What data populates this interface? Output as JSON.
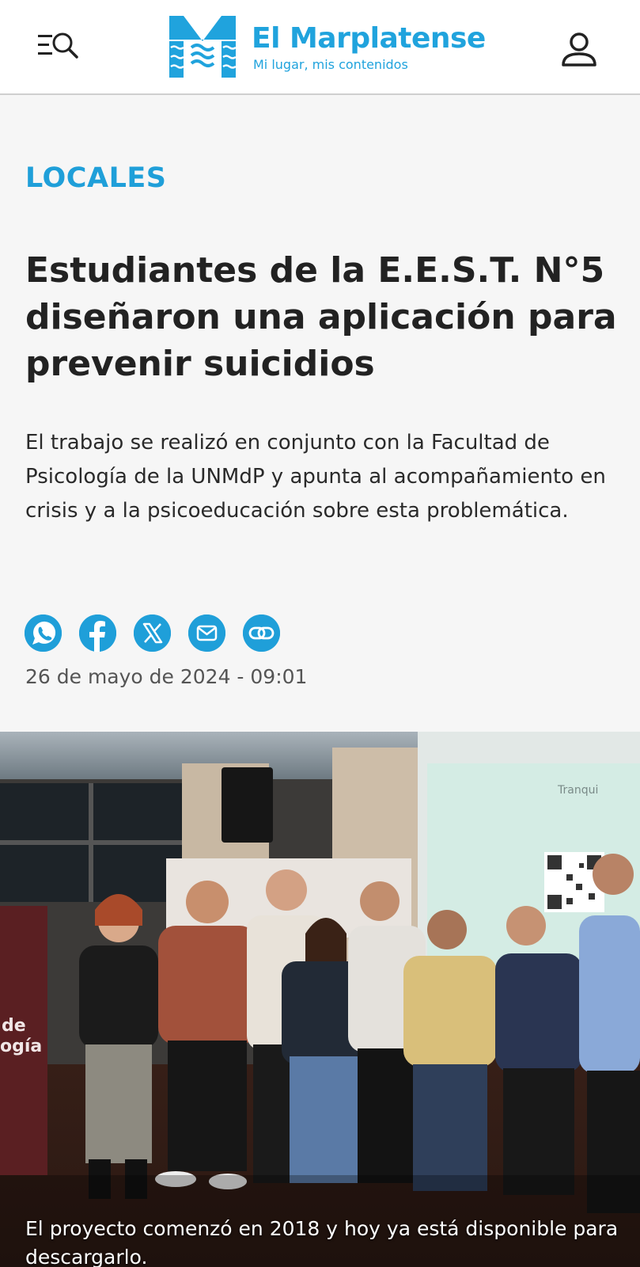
{
  "header": {
    "brand_name": "El Marplatense",
    "tagline": "Mi lugar, mis contenidos",
    "menu_icon": "menu-search-icon",
    "user_icon": "user-icon",
    "brand_color": "#20a3dd"
  },
  "article": {
    "category": "LOCALES",
    "title": "Estudiantes de la E.E.S.T. N°5 diseñaron una aplicación para prevenir suicidios",
    "summary": "El trabajo se realizó en conjunto con la Facultad de Psicología de la UNMdP y apunta al acompañamiento en crisis y a la psicoeducación sobre esta problemática.",
    "date": "26 de mayo de 2024 - 09:01",
    "share": [
      {
        "icon": "whatsapp-icon"
      },
      {
        "icon": "facebook-icon"
      },
      {
        "icon": "x-icon"
      },
      {
        "icon": "email-icon"
      },
      {
        "icon": "link-icon"
      }
    ],
    "accent_color": "#1f9fd9",
    "photo": {
      "screen_text": "Tranqui",
      "banner_text": "de\nogía",
      "caption": "El proyecto comenzó en 2018 y hoy ya está disponible para descargarlo."
    }
  }
}
